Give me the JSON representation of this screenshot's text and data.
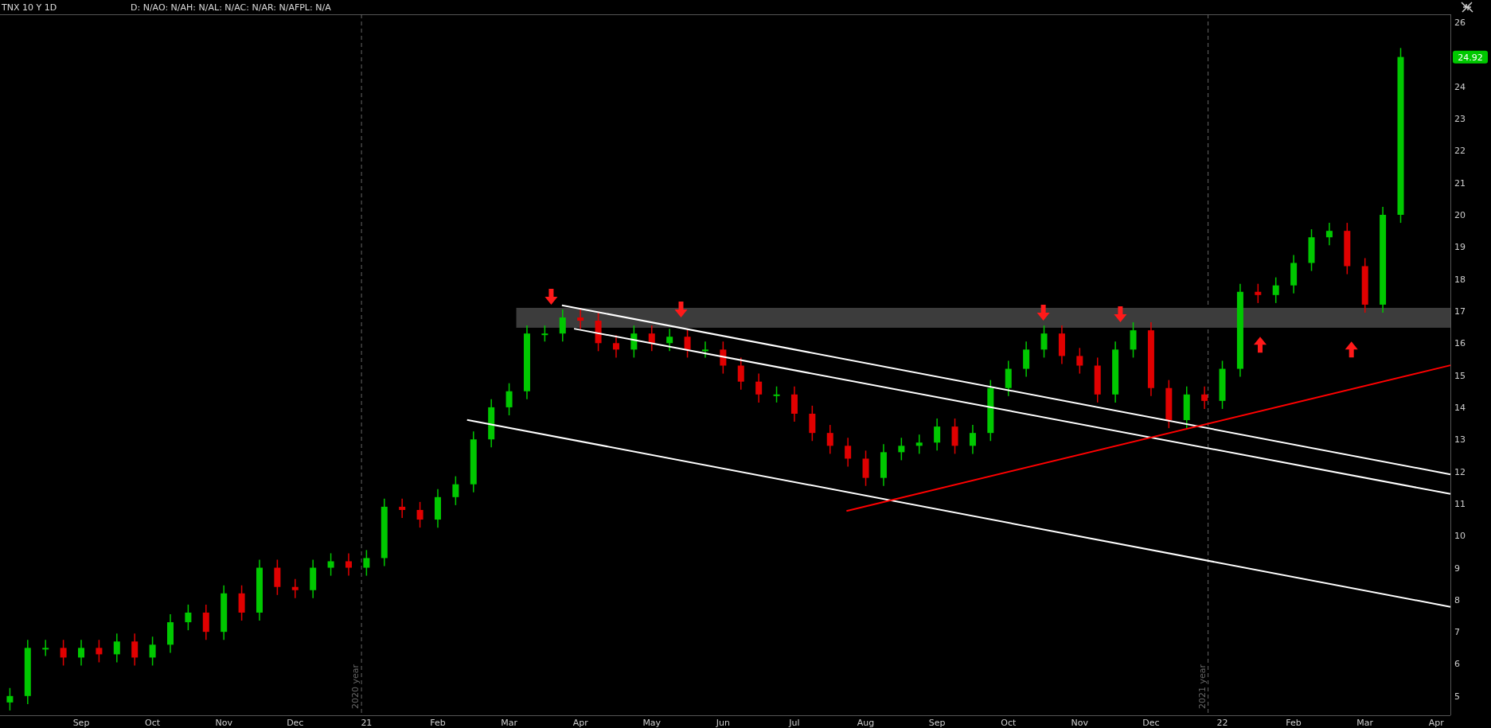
{
  "header": {
    "symbol": "TNX 10 Y 1D",
    "readout": "D: N/AO: N/AH: N/AL: N/AC: N/AR: N/AFPL: N/A"
  },
  "chart": {
    "last_price": "24.92",
    "chart_data": {
      "type": "candlestick",
      "categories": [
        null,
        null,
        null,
        null,
        "Sep",
        null,
        null,
        null,
        "Oct",
        null,
        null,
        null,
        "Nov",
        null,
        null,
        null,
        "Dec",
        null,
        null,
        null,
        "21",
        null,
        null,
        null,
        "Feb",
        null,
        null,
        null,
        "Mar",
        null,
        null,
        null,
        "Apr",
        null,
        null,
        null,
        "May",
        null,
        null,
        null,
        "Jun",
        null,
        null,
        null,
        "Jul",
        null,
        null,
        null,
        "Aug",
        null,
        null,
        null,
        "Sep",
        null,
        null,
        null,
        "Oct",
        null,
        null,
        null,
        "Nov",
        null,
        null,
        null,
        "Dec",
        null,
        null,
        null,
        "22",
        null,
        null,
        null,
        "Feb",
        null,
        null,
        null,
        "Mar",
        null,
        null,
        null,
        "Apr"
      ],
      "ohlc": [
        [
          4.8,
          5.25,
          4.55,
          5.0
        ],
        [
          5.0,
          6.75,
          4.75,
          6.5
        ],
        [
          6.5,
          6.75,
          6.25,
          6.5
        ],
        [
          6.5,
          6.75,
          5.95,
          6.2
        ],
        [
          6.2,
          6.75,
          5.95,
          6.5
        ],
        [
          6.5,
          6.75,
          6.05,
          6.3
        ],
        [
          6.3,
          6.95,
          6.05,
          6.7
        ],
        [
          6.7,
          6.95,
          5.95,
          6.2
        ],
        [
          6.2,
          6.85,
          5.95,
          6.6
        ],
        [
          6.6,
          7.55,
          6.35,
          7.3
        ],
        [
          7.3,
          7.85,
          7.05,
          7.6
        ],
        [
          7.6,
          7.85,
          6.75,
          7.0
        ],
        [
          7.0,
          8.45,
          6.75,
          8.2
        ],
        [
          8.2,
          8.45,
          7.35,
          7.6
        ],
        [
          7.6,
          9.25,
          7.35,
          9.0
        ],
        [
          9.0,
          9.25,
          8.15,
          8.4
        ],
        [
          8.4,
          8.65,
          8.05,
          8.3
        ],
        [
          8.3,
          9.25,
          8.05,
          9.0
        ],
        [
          9.0,
          9.45,
          8.75,
          9.2
        ],
        [
          9.2,
          9.45,
          8.75,
          9.0
        ],
        [
          9.0,
          9.55,
          8.75,
          9.3
        ],
        [
          9.3,
          11.15,
          9.05,
          10.9
        ],
        [
          10.9,
          11.15,
          10.55,
          10.8
        ],
        [
          10.8,
          11.05,
          10.25,
          10.5
        ],
        [
          10.5,
          11.45,
          10.25,
          11.2
        ],
        [
          11.2,
          11.85,
          10.95,
          11.6
        ],
        [
          11.6,
          13.25,
          11.35,
          13.0
        ],
        [
          13.0,
          14.25,
          12.75,
          14.0
        ],
        [
          14.0,
          14.75,
          13.75,
          14.5
        ],
        [
          14.5,
          16.55,
          14.25,
          16.3
        ],
        [
          16.3,
          16.55,
          16.05,
          16.3
        ],
        [
          16.3,
          17.05,
          16.05,
          16.8
        ],
        [
          16.8,
          17.05,
          16.45,
          16.7
        ],
        [
          16.7,
          16.95,
          15.75,
          16.0
        ],
        [
          16.0,
          16.25,
          15.55,
          15.8
        ],
        [
          15.8,
          16.55,
          15.55,
          16.3
        ],
        [
          16.3,
          16.55,
          15.75,
          16.0
        ],
        [
          16.0,
          16.45,
          15.75,
          16.2
        ],
        [
          16.2,
          16.45,
          15.55,
          15.8
        ],
        [
          15.8,
          16.05,
          15.55,
          15.8
        ],
        [
          15.8,
          16.05,
          15.05,
          15.3
        ],
        [
          15.3,
          15.55,
          14.55,
          14.8
        ],
        [
          14.8,
          15.05,
          14.15,
          14.4
        ],
        [
          14.4,
          14.65,
          14.15,
          14.4
        ],
        [
          14.4,
          14.65,
          13.55,
          13.8
        ],
        [
          13.8,
          14.05,
          12.95,
          13.2
        ],
        [
          13.2,
          13.45,
          12.55,
          12.8
        ],
        [
          12.8,
          13.05,
          12.15,
          12.4
        ],
        [
          12.4,
          12.65,
          11.55,
          11.8
        ],
        [
          11.8,
          12.85,
          11.55,
          12.6
        ],
        [
          12.6,
          13.05,
          12.35,
          12.8
        ],
        [
          12.8,
          13.15,
          12.55,
          12.9
        ],
        [
          12.9,
          13.65,
          12.65,
          13.4
        ],
        [
          13.4,
          13.65,
          12.55,
          12.8
        ],
        [
          12.8,
          13.45,
          12.55,
          13.2
        ],
        [
          13.2,
          14.85,
          12.95,
          14.6
        ],
        [
          14.6,
          15.45,
          14.35,
          15.2
        ],
        [
          15.2,
          16.05,
          14.95,
          15.8
        ],
        [
          15.8,
          16.55,
          15.55,
          16.3
        ],
        [
          16.3,
          16.55,
          15.35,
          15.6
        ],
        [
          15.6,
          15.85,
          15.05,
          15.3
        ],
        [
          15.3,
          15.55,
          14.15,
          14.4
        ],
        [
          14.4,
          16.05,
          14.15,
          15.8
        ],
        [
          15.8,
          16.65,
          15.55,
          16.4
        ],
        [
          16.4,
          16.65,
          14.35,
          14.6
        ],
        [
          14.6,
          14.85,
          13.35,
          13.6
        ],
        [
          13.6,
          14.65,
          13.35,
          14.4
        ],
        [
          14.4,
          14.65,
          13.95,
          14.2
        ],
        [
          14.2,
          15.45,
          13.95,
          15.2
        ],
        [
          15.2,
          17.85,
          14.95,
          17.6
        ],
        [
          17.6,
          17.85,
          17.25,
          17.5
        ],
        [
          17.5,
          18.05,
          17.25,
          17.8
        ],
        [
          17.8,
          18.75,
          17.55,
          18.5
        ],
        [
          18.5,
          19.55,
          18.25,
          19.3
        ],
        [
          19.3,
          19.75,
          19.05,
          19.5
        ],
        [
          19.5,
          19.75,
          18.15,
          18.4
        ],
        [
          18.4,
          18.65,
          16.95,
          17.2
        ],
        [
          17.2,
          20.25,
          16.95,
          20.0
        ],
        [
          20.0,
          25.2,
          19.75,
          24.92
        ],
        null,
        null
      ],
      "ylim": [
        4.4,
        26.25
      ],
      "yticks": [
        5,
        6,
        7,
        8,
        9,
        10,
        11,
        12,
        13,
        14,
        15,
        16,
        17,
        18,
        19,
        20,
        21,
        22,
        23,
        24,
        26
      ]
    },
    "year_labels": [
      "2020 year",
      "2021 year"
    ]
  }
}
